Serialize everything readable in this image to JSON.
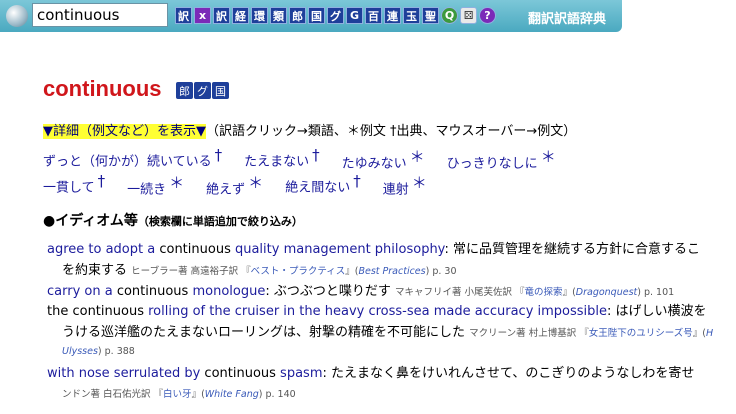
{
  "toolbar": {
    "search_value": "continuous",
    "buttons": [
      "訳",
      "x",
      "訳",
      "経",
      "環",
      "類",
      "郎",
      "国",
      "グ",
      "G",
      "百",
      "連",
      "玉",
      "聖",
      "Q",
      "⚄",
      "?"
    ],
    "label": "翻訳訳語辞典"
  },
  "headword": {
    "text": "continuous",
    "badges": [
      "郎",
      "グ",
      "国"
    ]
  },
  "details": {
    "toggle": "▼詳細（例文など）を表示▼",
    "note": "（訳語クリック→類語、＊例文 †出典、マウスオーバー→例文）"
  },
  "translations": [
    [
      {
        "text": "ずっと（何かが）続いている",
        "mark": "†"
      },
      {
        "text": "たえまない",
        "mark": "†"
      },
      {
        "text": "たゆみない",
        "mark": "＊"
      },
      {
        "text": "ひっきりなしに",
        "mark": "＊"
      }
    ],
    [
      {
        "text": "一貫して",
        "mark": "†"
      },
      {
        "text": "一続き",
        "mark": "＊"
      },
      {
        "text": "絶えず",
        "mark": "＊"
      },
      {
        "text": "絶え間ない",
        "mark": "†"
      },
      {
        "text": "連射",
        "mark": "＊"
      }
    ]
  ],
  "idioms": {
    "heading": "●イディオム等",
    "heading_note": "（検索欄に単語追加で絞り込み）",
    "items": [
      {
        "en_a": "agree to adopt a ",
        "en_b": "continuous",
        "en_c": " quality management philosophy",
        "ja": "常に品質管理を継続する方針に合意するこ",
        "ja2": "を約束する",
        "src_a": "ヒーブラー著 高遠裕子訳 『",
        "src_book": "ベスト・プラクティス",
        "src_b": "』(",
        "src_en": "Best Practices",
        "src_c": ") p. 30"
      },
      {
        "en_a": "carry on a ",
        "en_b": "continuous",
        "en_c": " monologue",
        "ja": "ぶつぶつと喋りだす",
        "src_a": "マキャフリイ著 小尾芙佐訳 『",
        "src_book": "竜の探索",
        "src_b": "』(",
        "src_en": "Dragonquest",
        "src_c": ") p. 101"
      },
      {
        "en_a": "the ",
        "en_b": "continuous",
        "en_c": " rolling of the cruiser in the heavy cross-sea made accuracy impossible",
        "ja": "はげしい横波を",
        "ja2": "うける巡洋艦のたえまないローリングは、射撃の精確を不可能にした",
        "src_a": "マクリーン著 村上博基訳 『",
        "src_book": "女王陛下のユリシーズ号",
        "src_b": "』(",
        "src_en": "H",
        "src_en2": "Ulysses",
        "src_c": ") p. 388"
      },
      {
        "en_a": "with nose serrulated by ",
        "en_b": "continuous",
        "en_c": " spasm",
        "ja": "たえまなく鼻をけいれんさせて、のこぎりのようなしわを寄せ",
        "src_a": "ンドン著 白石佑光訳 『",
        "src_book": "白い牙",
        "src_b": "』(",
        "src_en": "White Fang",
        "src_c": ") p. 140"
      }
    ]
  }
}
